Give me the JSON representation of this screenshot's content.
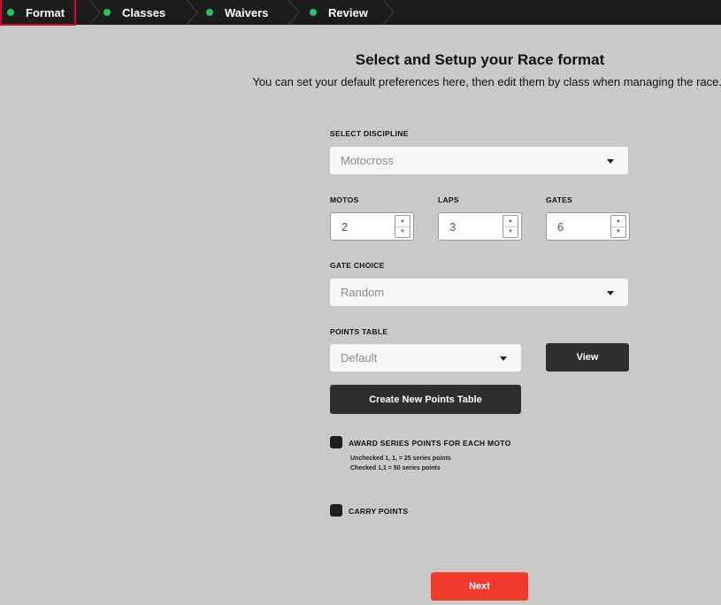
{
  "steps": [
    {
      "label": "Format",
      "active": true
    },
    {
      "label": "Classes",
      "active": false
    },
    {
      "label": "Waivers",
      "active": false
    },
    {
      "label": "Review",
      "active": false
    }
  ],
  "colors": {
    "step_dot": "#22c55e",
    "active_outline": "#c8102e",
    "next": "#f13a2b",
    "dark_button": "#2e2e2e"
  },
  "header": {
    "title": "Select and Setup your Race format",
    "subtitle": "You can set your default preferences here, then edit them by class when managing the race."
  },
  "form": {
    "discipline": {
      "label": "SELECT DISCIPLINE",
      "value": "Motocross"
    },
    "motos": {
      "label": "MOTOS",
      "value": "2"
    },
    "laps": {
      "label": "LAPS",
      "value": "3"
    },
    "gates": {
      "label": "GATES",
      "value": "6"
    },
    "gate_choice": {
      "label": "GATE CHOICE",
      "value": "Random"
    },
    "points_table": {
      "label": "POINTS TABLE",
      "value": "Default",
      "view_label": "View"
    },
    "create_points_table_label": "Create New Points Table",
    "award_series": {
      "label": "AWARD SERIES POINTS FOR EACH MOTO",
      "note_line1": "Unchecked 1, 1, = 25 series points",
      "note_line2": "Checked 1,1 = 50 series points"
    },
    "carry_points": {
      "label": "CARRY POINTS"
    }
  },
  "footer": {
    "next_label": "Next"
  }
}
